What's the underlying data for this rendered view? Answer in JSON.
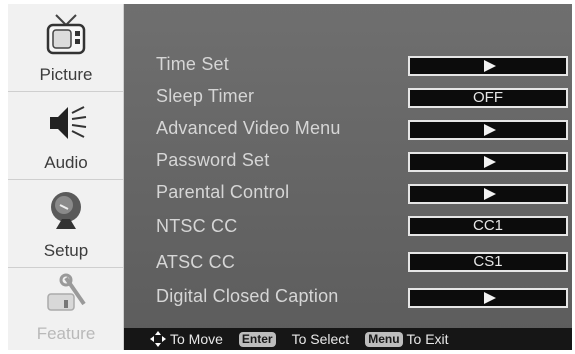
{
  "sidebar": {
    "items": [
      {
        "label": "Picture",
        "icon": "tv-icon"
      },
      {
        "label": "Audio",
        "icon": "speaker-icon"
      },
      {
        "label": "Setup",
        "icon": "satellite-dish-icon"
      },
      {
        "label": "Feature",
        "icon": "tools-icon"
      }
    ]
  },
  "menu": {
    "rows": [
      {
        "label": "Time Set",
        "value": ""
      },
      {
        "label": "Sleep Timer",
        "value": "OFF"
      },
      {
        "label": "Advanced Video Menu",
        "value": ""
      },
      {
        "label": "Password Set",
        "value": ""
      },
      {
        "label": "Parental Control",
        "value": ""
      },
      {
        "label": "NTSC CC",
        "value": "CC1"
      },
      {
        "label": "ATSC CC",
        "value": "CS1"
      },
      {
        "label": "Digital Closed Caption",
        "value": ""
      }
    ]
  },
  "footer": {
    "move_label": "To Move",
    "enter_key": "Enter",
    "select_label": "To Select",
    "menu_key": "Menu",
    "exit_label": "To Exit"
  },
  "colors": {
    "panel": "#6a6a6a",
    "sidebar": "#f1f1f1",
    "value_box": "#0c0c0c"
  }
}
